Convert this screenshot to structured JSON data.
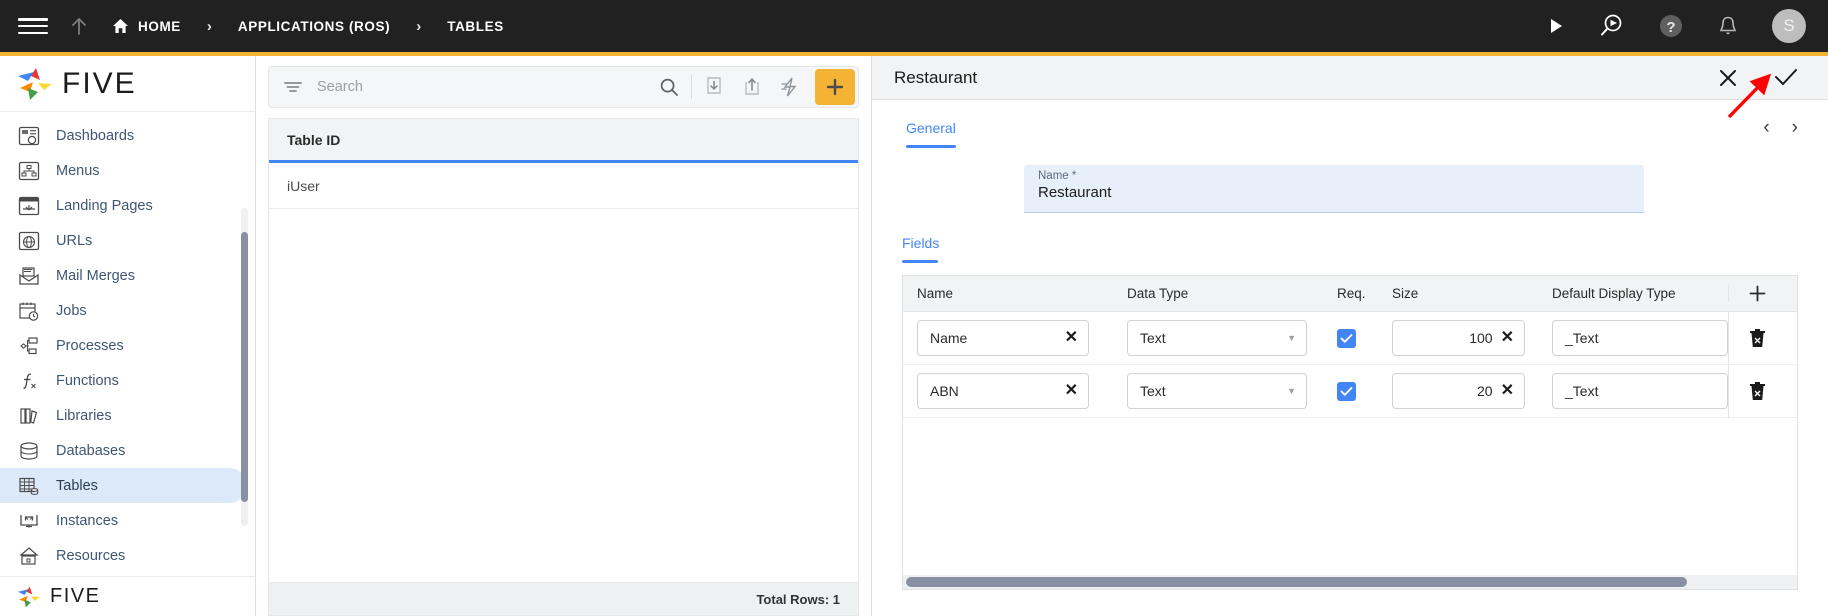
{
  "topbar": {
    "menu_icon": "hamburger-icon",
    "up_icon": "arrow-up-icon",
    "breadcrumbs": [
      {
        "label": "HOME",
        "icon": "home-icon"
      },
      {
        "label": "APPLICATIONS (ROS)",
        "icon": ""
      },
      {
        "label": "TABLES",
        "icon": ""
      }
    ],
    "separator": "›",
    "actions": [
      {
        "name": "run-icon",
        "label": "Run"
      },
      {
        "name": "debug-search-icon",
        "label": "Debug"
      },
      {
        "name": "help-icon",
        "label": "Help"
      },
      {
        "name": "notifications-bell-icon",
        "label": "Notifications"
      }
    ],
    "avatar_initial": "S",
    "accent_color": "#F5B335",
    "background_color": "#212121"
  },
  "sidebar": {
    "brand": "FIVE",
    "brand_bottom": "FIVE",
    "items": [
      {
        "label": "Dashboards",
        "icon": "dashboard-icon",
        "active": false
      },
      {
        "label": "Menus",
        "icon": "menus-icon",
        "active": false
      },
      {
        "label": "Landing Pages",
        "icon": "landing-pages-icon",
        "active": false
      },
      {
        "label": "URLs",
        "icon": "globe-icon",
        "active": false
      },
      {
        "label": "Mail Merges",
        "icon": "mail-merge-icon",
        "active": false
      },
      {
        "label": "Jobs",
        "icon": "jobs-calendar-icon",
        "active": false
      },
      {
        "label": "Processes",
        "icon": "processes-icon",
        "active": false
      },
      {
        "label": "Functions",
        "icon": "functions-icon",
        "active": false
      },
      {
        "label": "Libraries",
        "icon": "libraries-icon",
        "active": false
      },
      {
        "label": "Databases",
        "icon": "database-icon",
        "active": false
      },
      {
        "label": "Tables",
        "icon": "tables-icon",
        "active": true
      },
      {
        "label": "Instances",
        "icon": "instances-icon",
        "active": false
      },
      {
        "label": "Resources",
        "icon": "resources-icon",
        "active": false
      }
    ]
  },
  "list_panel": {
    "search": {
      "value": "",
      "placeholder": "Search"
    },
    "toolbar": [
      {
        "name": "filter-icon",
        "label": "Filter"
      },
      {
        "name": "search-icon",
        "label": "Search"
      },
      {
        "name": "import-icon",
        "label": "Import"
      },
      {
        "name": "export-icon",
        "label": "Export"
      },
      {
        "name": "lightning-icon",
        "label": "Quick Action"
      },
      {
        "name": "add-icon",
        "label": "Add"
      }
    ],
    "column_header": "Table ID",
    "rows": [
      {
        "table_id": "iUser"
      }
    ],
    "footer": "Total Rows: 1"
  },
  "detail": {
    "title": "Restaurant",
    "header_actions": [
      {
        "name": "close-icon",
        "label": "Close"
      },
      {
        "name": "save-check-icon",
        "label": "Save"
      }
    ],
    "tabs": [
      {
        "label": "General",
        "active": true
      }
    ],
    "pager": {
      "prev": "‹",
      "next": "›"
    },
    "name_field": {
      "label": "Name *",
      "value": "Restaurant"
    },
    "fields_section": {
      "tab_label": "Fields",
      "columns": [
        "Name",
        "Data Type",
        "Req.",
        "Size",
        "Default Display Type"
      ],
      "add_button": "+",
      "rows": [
        {
          "name": "Name",
          "data_type": "Text",
          "required": true,
          "size": "100",
          "default_display_type": "_Text",
          "delete_icon": "trash-icon"
        },
        {
          "name": "ABN",
          "data_type": "Text",
          "required": true,
          "size": "20",
          "default_display_type": "_Text",
          "delete_icon": "trash-icon"
        }
      ]
    },
    "scroll": {
      "thumb_percent": 88
    }
  },
  "annotation": {
    "type": "arrow",
    "color": "#FF0000",
    "points_to": "save-check-icon"
  },
  "colors": {
    "accent_blue": "#4285F4",
    "amber": "#F5B335",
    "header_dark": "#212121",
    "field_bg": "#E6EFFA"
  }
}
